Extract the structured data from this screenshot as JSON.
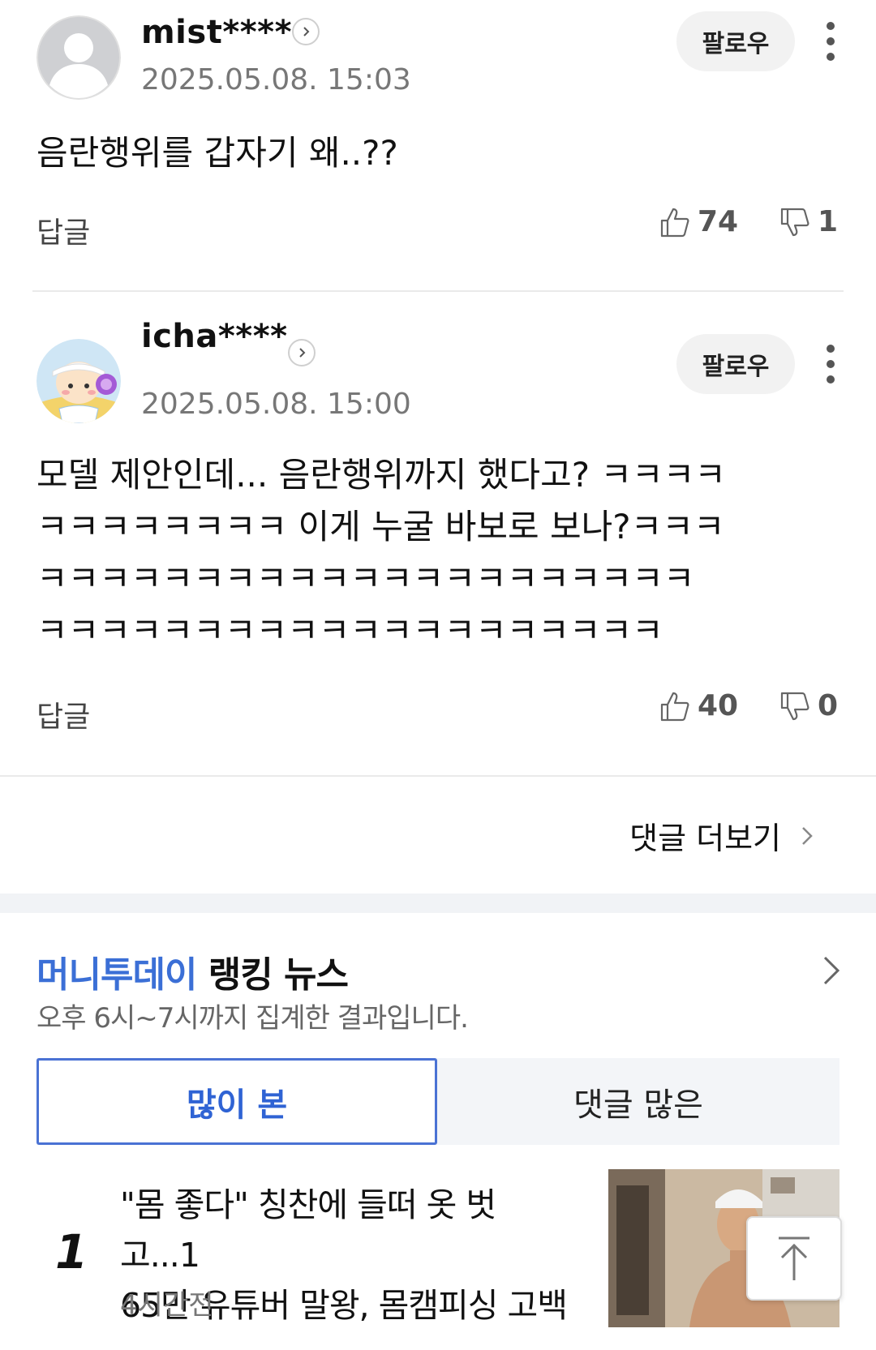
{
  "comments": [
    {
      "nickname": "mist****",
      "date": "2025.05.08. 15:03",
      "follow_label": "팔로우",
      "text": "음란행위를 갑자기 왜..??",
      "reply_label": "답글",
      "likes": "74",
      "dislikes": "1",
      "avatar": "default-user-icon"
    },
    {
      "nickname": "icha****",
      "date": "2025.05.08. 15:00",
      "follow_label": "팔로우",
      "text_lines": [
        "모델 제안인데... 음란행위까지 했다고? ㅋㅋㅋㅋ",
        "ㅋㅋㅋㅋㅋㅋㅋㅋ 이게 누굴 바보로 보나?ㅋㅋㅋ",
        "ㅋㅋㅋㅋㅋㅋㅋㅋㅋㅋㅋㅋㅋㅋㅋㅋㅋㅋㅋㅋㅋ",
        "ㅋㅋㅋㅋㅋㅋㅋㅋㅋㅋㅋㅋㅋㅋㅋㅋㅋㅋㅋㅋ"
      ],
      "reply_label": "답글",
      "likes": "40",
      "dislikes": "0",
      "avatar": "character-avatar"
    }
  ],
  "more_comments_label": "댓글 더보기",
  "ranking": {
    "brand": "머니투데이",
    "title_rest": " 랭킹 뉴스",
    "subtitle": "오후 6시~7시까지 집계한 결과입니다.",
    "tabs": [
      "많이 본",
      "댓글 많은"
    ],
    "active_tab": 0,
    "items": [
      {
        "rank": "1",
        "title_lines": [
          "\"몸 좋다\" 칭찬에 들떠 옷 벗고...1",
          "65만 유튜버 말왕, 몸캠피싱 고백"
        ],
        "time": "4시간전"
      }
    ]
  },
  "colors": {
    "accent": "#3b6fd6",
    "tab_border": "#4a72d4",
    "divider": "#eaeaea",
    "band": "#f1f3f6"
  },
  "icons": [
    "chevron-right-icon",
    "more-vertical-icon",
    "thumbs-up-icon",
    "thumbs-down-icon",
    "scroll-top-icon"
  ]
}
